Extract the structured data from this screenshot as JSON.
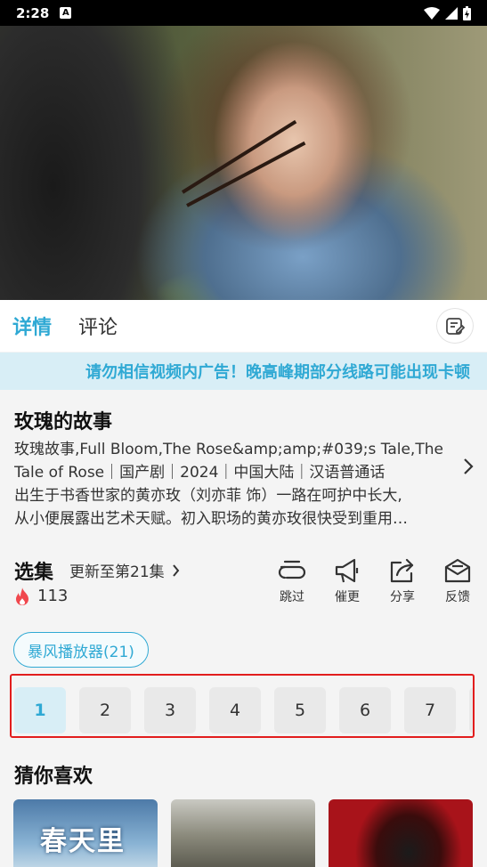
{
  "status_bar": {
    "time": "2:28",
    "a_badge": "A"
  },
  "tabs": {
    "details": "详情",
    "comments": "评论"
  },
  "marquee": "请勿相信视频内广告！晚高峰期部分线路可能出现卡顿",
  "show": {
    "title": "玫瑰的故事",
    "description_lines": [
      "玫瑰故事,Full Bloom,The Rose&amp;amp;#039;s Tale,The",
      "Tale of Rose｜国产剧｜2024｜中国大陆｜汉语普通话",
      "出生于书香世家的黄亦玫（刘亦菲 饰）一路在呵护中长大,",
      "从小便展露出艺术天赋。初入职场的黄亦玫很快受到重用…"
    ]
  },
  "episodes": {
    "label": "选集",
    "update": "更新至第21集",
    "heat": "113",
    "player": "暴风播放器(21)",
    "items": [
      "1",
      "2",
      "3",
      "4",
      "5",
      "6",
      "7"
    ]
  },
  "actions": {
    "skip": "跳过",
    "urge": "催更",
    "share": "分享",
    "feedback": "反馈"
  },
  "recommend": {
    "title": "猜你喜欢",
    "poster1_text": "春天里"
  },
  "colors": {
    "accent": "#2fa9d4",
    "highlight_border": "#e21d1d",
    "fire": "#f0474d"
  }
}
